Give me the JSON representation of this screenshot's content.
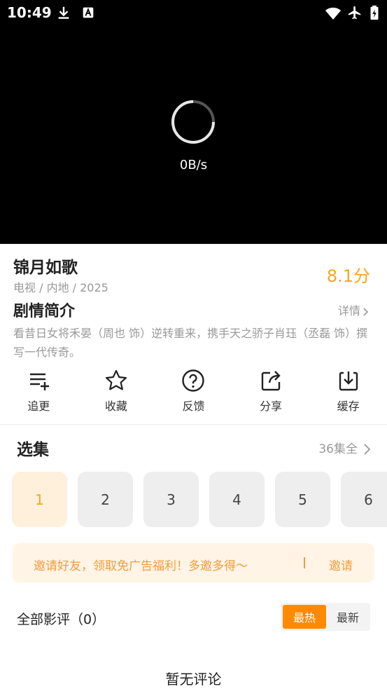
{
  "status_bar": {
    "time": "10:49",
    "icons": [
      "download-icon",
      "font-a-icon",
      "wifi-icon",
      "airplane-icon",
      "battery-charging-icon"
    ]
  },
  "player": {
    "speed": "0B/s",
    "icon": "loading-spinner-icon"
  },
  "show": {
    "title": "锦月如歌",
    "meta": "电视 / 内地 / 2025",
    "score": "8.1分",
    "synopsis_heading": "剧情简介",
    "details_label": "详情",
    "synopsis": "看昔日女将禾晏（周也 饰）逆转重来，携手天之骄子肖珏（丞磊 饰）撰写一代传奇。"
  },
  "actions": [
    {
      "label": "追更",
      "icon": "playlist-add-icon"
    },
    {
      "label": "收藏",
      "icon": "star-icon"
    },
    {
      "label": "反馈",
      "icon": "help-circle-icon"
    },
    {
      "label": "分享",
      "icon": "share-icon"
    },
    {
      "label": "缓存",
      "icon": "download-icon"
    }
  ],
  "episodes": {
    "heading": "选集",
    "total": "36集全",
    "items": [
      "1",
      "2",
      "3",
      "4",
      "5",
      "6"
    ],
    "selected": "1"
  },
  "invite": {
    "text": "邀请好友，领取免广告福利！多邀多得～",
    "button": "邀请"
  },
  "reviews": {
    "heading": "全部影评（0）",
    "sort_options": [
      "最热",
      "最新"
    ],
    "selected_sort": "最热",
    "empty_text": "暂无评论"
  },
  "colors": {
    "accent": "#f5a623",
    "sort_active": "#ff8a00",
    "invite_bg": "#fff4e6"
  }
}
